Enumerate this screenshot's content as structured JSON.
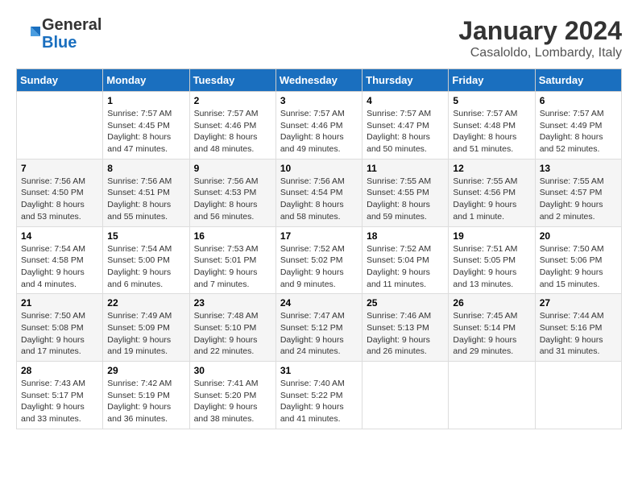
{
  "header": {
    "logo_line1": "General",
    "logo_line2": "Blue",
    "month": "January 2024",
    "location": "Casaloldo, Lombardy, Italy"
  },
  "weekdays": [
    "Sunday",
    "Monday",
    "Tuesday",
    "Wednesday",
    "Thursday",
    "Friday",
    "Saturday"
  ],
  "weeks": [
    [
      {
        "day": "",
        "info": ""
      },
      {
        "day": "1",
        "info": "Sunrise: 7:57 AM\nSunset: 4:45 PM\nDaylight: 8 hours\nand 47 minutes."
      },
      {
        "day": "2",
        "info": "Sunrise: 7:57 AM\nSunset: 4:46 PM\nDaylight: 8 hours\nand 48 minutes."
      },
      {
        "day": "3",
        "info": "Sunrise: 7:57 AM\nSunset: 4:46 PM\nDaylight: 8 hours\nand 49 minutes."
      },
      {
        "day": "4",
        "info": "Sunrise: 7:57 AM\nSunset: 4:47 PM\nDaylight: 8 hours\nand 50 minutes."
      },
      {
        "day": "5",
        "info": "Sunrise: 7:57 AM\nSunset: 4:48 PM\nDaylight: 8 hours\nand 51 minutes."
      },
      {
        "day": "6",
        "info": "Sunrise: 7:57 AM\nSunset: 4:49 PM\nDaylight: 8 hours\nand 52 minutes."
      }
    ],
    [
      {
        "day": "7",
        "info": "Sunrise: 7:56 AM\nSunset: 4:50 PM\nDaylight: 8 hours\nand 53 minutes."
      },
      {
        "day": "8",
        "info": "Sunrise: 7:56 AM\nSunset: 4:51 PM\nDaylight: 8 hours\nand 55 minutes."
      },
      {
        "day": "9",
        "info": "Sunrise: 7:56 AM\nSunset: 4:53 PM\nDaylight: 8 hours\nand 56 minutes."
      },
      {
        "day": "10",
        "info": "Sunrise: 7:56 AM\nSunset: 4:54 PM\nDaylight: 8 hours\nand 58 minutes."
      },
      {
        "day": "11",
        "info": "Sunrise: 7:55 AM\nSunset: 4:55 PM\nDaylight: 8 hours\nand 59 minutes."
      },
      {
        "day": "12",
        "info": "Sunrise: 7:55 AM\nSunset: 4:56 PM\nDaylight: 9 hours\nand 1 minute."
      },
      {
        "day": "13",
        "info": "Sunrise: 7:55 AM\nSunset: 4:57 PM\nDaylight: 9 hours\nand 2 minutes."
      }
    ],
    [
      {
        "day": "14",
        "info": "Sunrise: 7:54 AM\nSunset: 4:58 PM\nDaylight: 9 hours\nand 4 minutes."
      },
      {
        "day": "15",
        "info": "Sunrise: 7:54 AM\nSunset: 5:00 PM\nDaylight: 9 hours\nand 6 minutes."
      },
      {
        "day": "16",
        "info": "Sunrise: 7:53 AM\nSunset: 5:01 PM\nDaylight: 9 hours\nand 7 minutes."
      },
      {
        "day": "17",
        "info": "Sunrise: 7:52 AM\nSunset: 5:02 PM\nDaylight: 9 hours\nand 9 minutes."
      },
      {
        "day": "18",
        "info": "Sunrise: 7:52 AM\nSunset: 5:04 PM\nDaylight: 9 hours\nand 11 minutes."
      },
      {
        "day": "19",
        "info": "Sunrise: 7:51 AM\nSunset: 5:05 PM\nDaylight: 9 hours\nand 13 minutes."
      },
      {
        "day": "20",
        "info": "Sunrise: 7:50 AM\nSunset: 5:06 PM\nDaylight: 9 hours\nand 15 minutes."
      }
    ],
    [
      {
        "day": "21",
        "info": "Sunrise: 7:50 AM\nSunset: 5:08 PM\nDaylight: 9 hours\nand 17 minutes."
      },
      {
        "day": "22",
        "info": "Sunrise: 7:49 AM\nSunset: 5:09 PM\nDaylight: 9 hours\nand 19 minutes."
      },
      {
        "day": "23",
        "info": "Sunrise: 7:48 AM\nSunset: 5:10 PM\nDaylight: 9 hours\nand 22 minutes."
      },
      {
        "day": "24",
        "info": "Sunrise: 7:47 AM\nSunset: 5:12 PM\nDaylight: 9 hours\nand 24 minutes."
      },
      {
        "day": "25",
        "info": "Sunrise: 7:46 AM\nSunset: 5:13 PM\nDaylight: 9 hours\nand 26 minutes."
      },
      {
        "day": "26",
        "info": "Sunrise: 7:45 AM\nSunset: 5:14 PM\nDaylight: 9 hours\nand 29 minutes."
      },
      {
        "day": "27",
        "info": "Sunrise: 7:44 AM\nSunset: 5:16 PM\nDaylight: 9 hours\nand 31 minutes."
      }
    ],
    [
      {
        "day": "28",
        "info": "Sunrise: 7:43 AM\nSunset: 5:17 PM\nDaylight: 9 hours\nand 33 minutes."
      },
      {
        "day": "29",
        "info": "Sunrise: 7:42 AM\nSunset: 5:19 PM\nDaylight: 9 hours\nand 36 minutes."
      },
      {
        "day": "30",
        "info": "Sunrise: 7:41 AM\nSunset: 5:20 PM\nDaylight: 9 hours\nand 38 minutes."
      },
      {
        "day": "31",
        "info": "Sunrise: 7:40 AM\nSunset: 5:22 PM\nDaylight: 9 hours\nand 41 minutes."
      },
      {
        "day": "",
        "info": ""
      },
      {
        "day": "",
        "info": ""
      },
      {
        "day": "",
        "info": ""
      }
    ]
  ]
}
